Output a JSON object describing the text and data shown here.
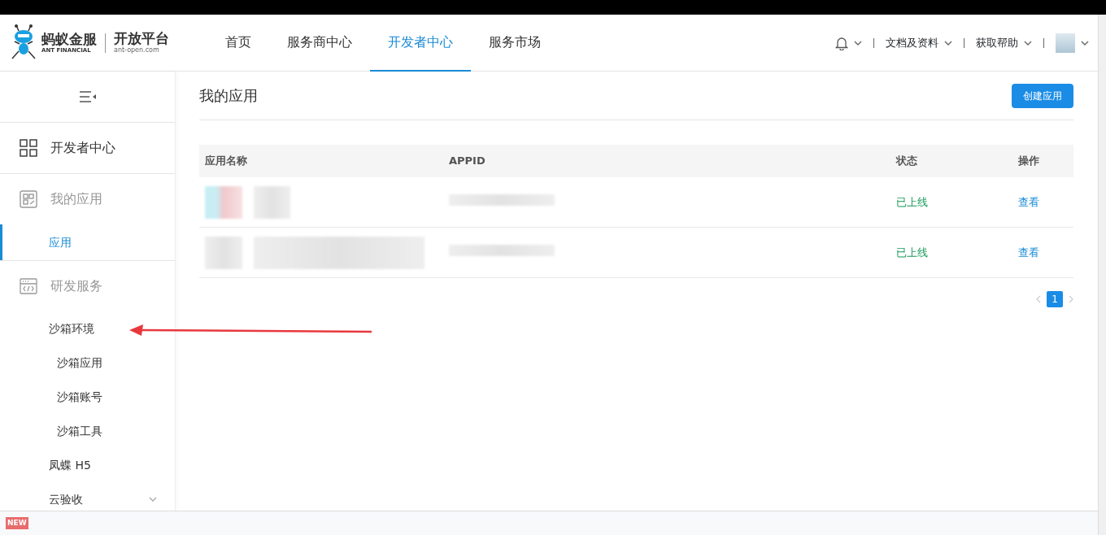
{
  "header": {
    "logo": {
      "brand": "蚂蚁金服",
      "brand_en": "ANT FINANCIAL",
      "product": "开放平台",
      "domain": "ant-open.com"
    },
    "tabs": [
      {
        "label": "首页",
        "selected": false
      },
      {
        "label": "服务商中心",
        "selected": false
      },
      {
        "label": "开发者中心",
        "selected": true
      },
      {
        "label": "服务市场",
        "selected": false
      }
    ],
    "menus": [
      {
        "kind": "bell"
      },
      {
        "kind": "text",
        "label": "文档及资料"
      },
      {
        "kind": "text",
        "label": "获取帮助"
      },
      {
        "kind": "avatar"
      }
    ]
  },
  "sidebar": {
    "items": [
      {
        "kind": "home",
        "label": "开发者中心"
      },
      {
        "kind": "apps",
        "label": "我的应用",
        "children": [
          {
            "label": "应用",
            "selected": true
          }
        ]
      },
      {
        "kind": "dev",
        "label": "研发服务",
        "children": [
          {
            "label": "沙箱环境",
            "selected": false,
            "children": [
              {
                "label": "沙箱应用",
                "selected": false
              },
              {
                "label": "沙箱账号",
                "selected": false
              },
              {
                "label": "沙箱工具",
                "selected": false
              }
            ]
          },
          {
            "label": "凤蝶 H5",
            "selected": false
          },
          {
            "label": "云验收",
            "selected": false,
            "expanded": false
          }
        ]
      }
    ]
  },
  "main": {
    "title": "我的应用",
    "create_button": "创建应用",
    "table": {
      "columns": [
        "应用名称",
        "APPID",
        "状态",
        "操作"
      ],
      "rows": [
        {
          "status": "已上线",
          "action": "查看"
        },
        {
          "status": "已上线",
          "action": "查看"
        }
      ]
    },
    "pagination": {
      "pages": [
        {
          "label": "1",
          "selected": true
        }
      ]
    }
  },
  "footer": {
    "badge": "NEW"
  }
}
